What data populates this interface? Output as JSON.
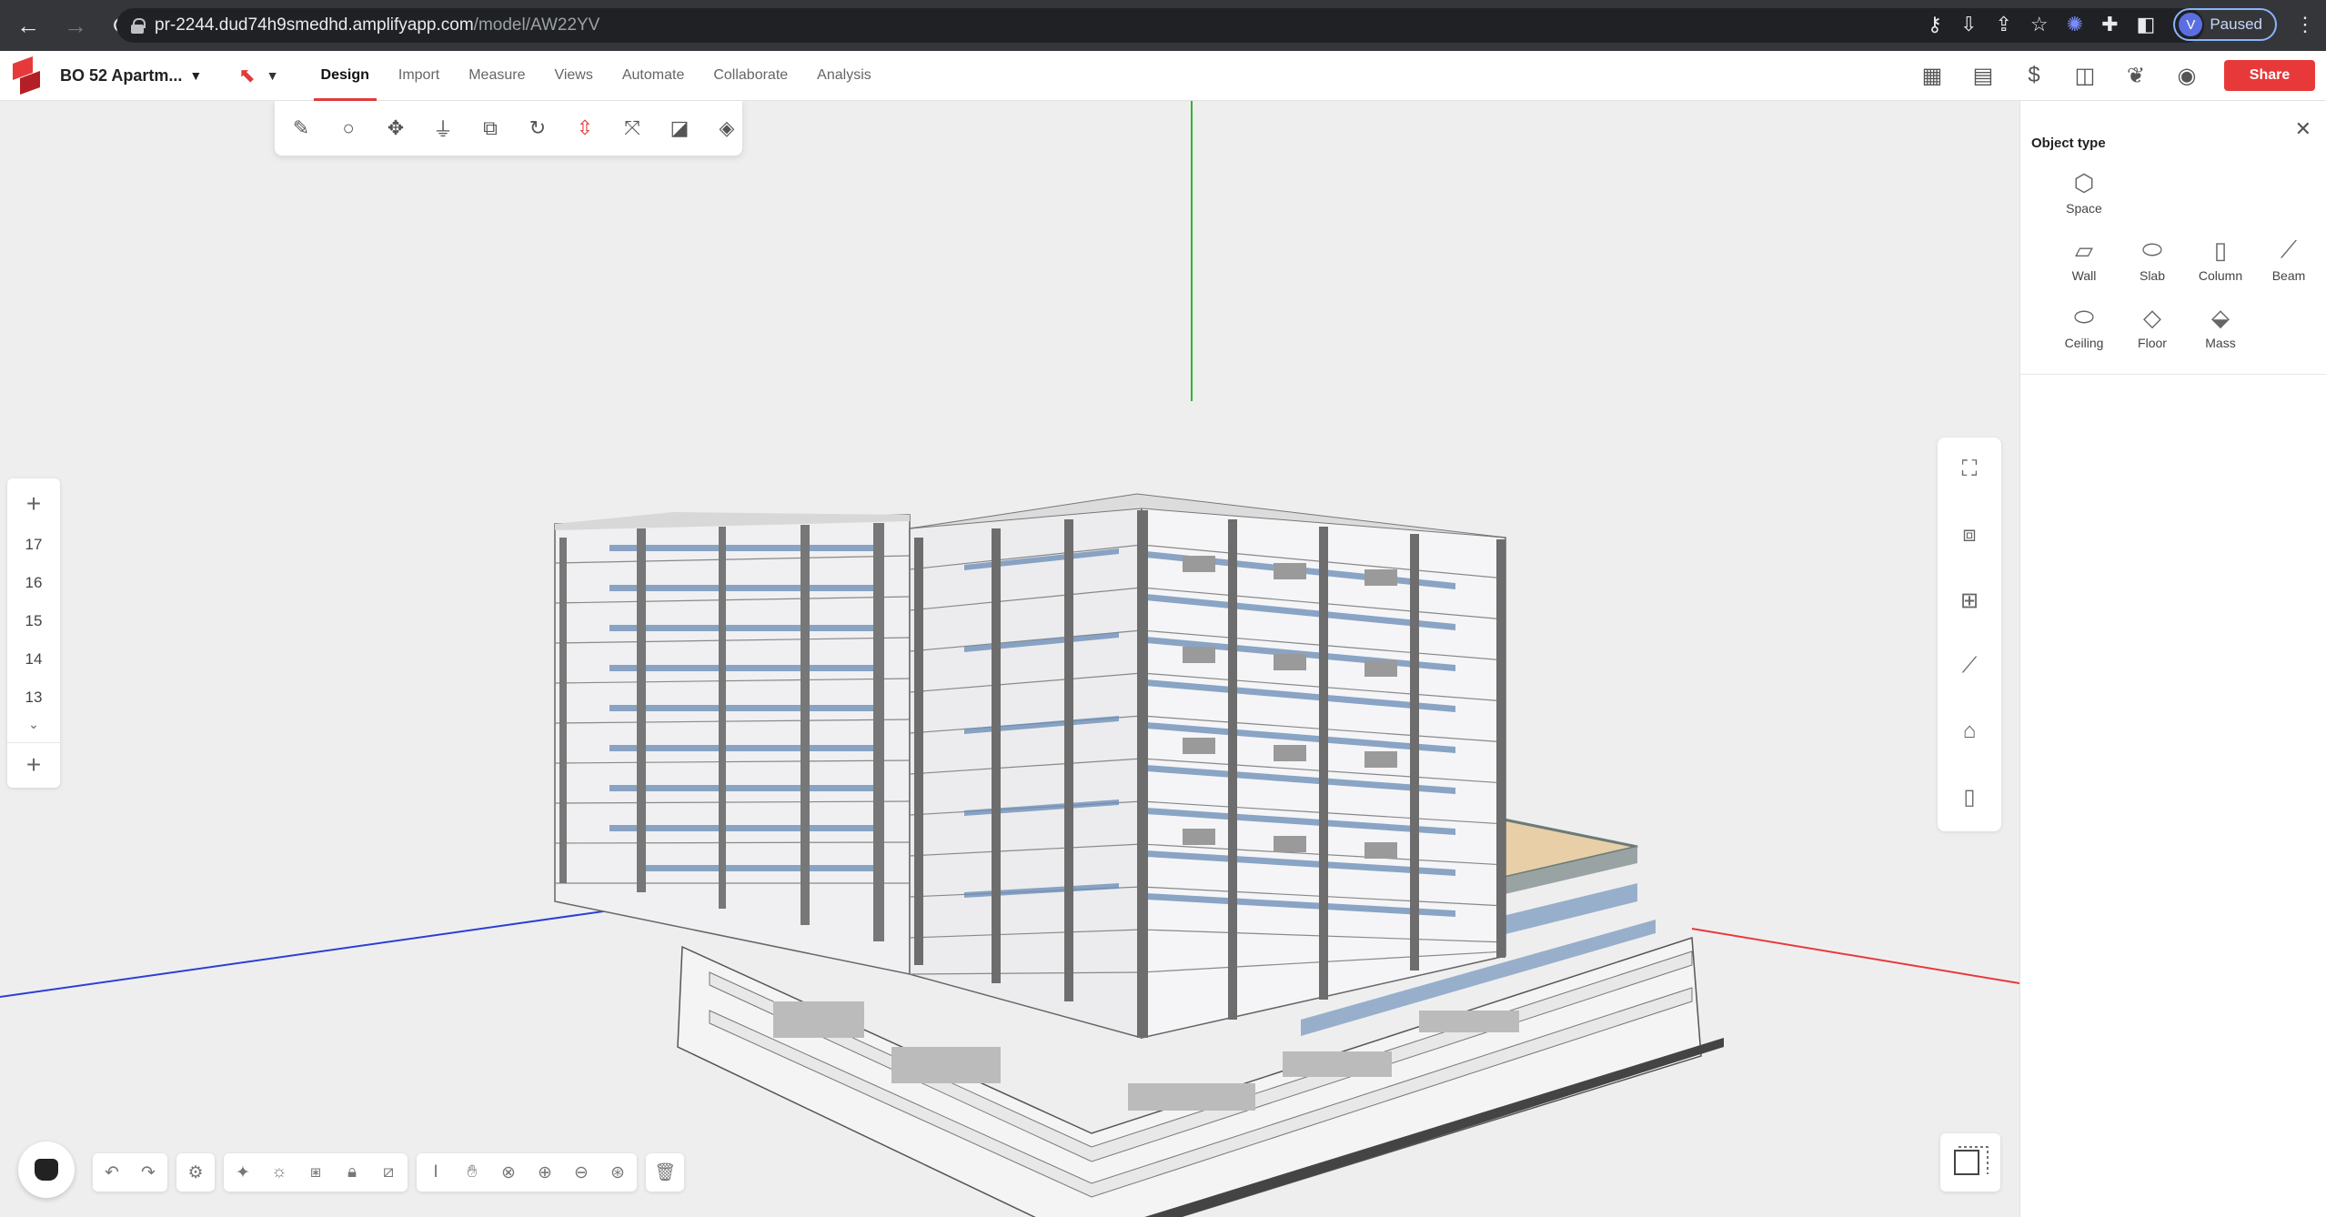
{
  "browser": {
    "url_host": "pr-2244.dud74h9smedhd.amplifyapp.com",
    "url_path": "/model/AW22YV",
    "profile_initial": "V",
    "profile_status": "Paused"
  },
  "header": {
    "project_name": "BO 52 Apartm...",
    "tabs": [
      {
        "label": "Design",
        "active": true
      },
      {
        "label": "Import",
        "active": false
      },
      {
        "label": "Measure",
        "active": false
      },
      {
        "label": "Views",
        "active": false
      },
      {
        "label": "Automate",
        "active": false
      },
      {
        "label": "Collaborate",
        "active": false
      },
      {
        "label": "Analysis",
        "active": false
      }
    ],
    "share_label": "Share",
    "accent_color": "#e8393a"
  },
  "levels": {
    "items": [
      "17",
      "16",
      "15",
      "14",
      "13"
    ]
  },
  "panel": {
    "title": "Object type",
    "objects": [
      {
        "label": "Space",
        "icon": "cube-icon"
      },
      {
        "label": "Wall",
        "icon": "wall-icon"
      },
      {
        "label": "Slab",
        "icon": "slab-icon"
      },
      {
        "label": "Column",
        "icon": "column-icon"
      },
      {
        "label": "Beam",
        "icon": "beam-icon"
      },
      {
        "label": "Ceiling",
        "icon": "ceiling-icon"
      },
      {
        "label": "Floor",
        "icon": "floor-icon"
      },
      {
        "label": "Mass",
        "icon": "mass-icon"
      }
    ]
  },
  "axes": {
    "x_color": "#e8393a",
    "y_color": "#2fb52f",
    "z_color": "#2b3fd6"
  }
}
